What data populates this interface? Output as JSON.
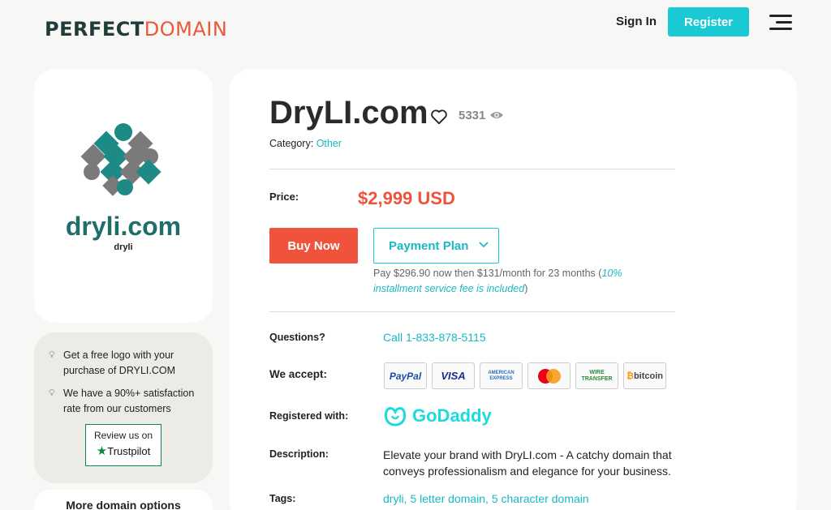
{
  "header": {
    "logo_part1": "PERFECT",
    "logo_part2": "DOMAIN",
    "sign_in": "Sign In",
    "register": "Register"
  },
  "sidebar": {
    "domain_logo_text": "dryli.com",
    "domain_logo_sub": "dryli",
    "info": [
      {
        "text": "Get a free logo with your purchase of DRYLI.COM"
      },
      {
        "text": "We have a 90%+ satisfaction rate from our customers"
      }
    ],
    "trustpilot_review": "Review us on",
    "trustpilot_name": "Trustpilot",
    "more_options": "More domain options"
  },
  "main": {
    "domain_title": "DryLI.com",
    "views": "5331",
    "category_label": "Category:",
    "category_value": "Other",
    "price_label": "Price:",
    "price_value": "$2,999 USD",
    "buy_now": "Buy Now",
    "payment_plan": "Payment Plan",
    "plan_note": "Pay $296.90 now then $131/month for 23 months",
    "plan_note_open": "(",
    "plan_note_fee": "10% installment service fee is included",
    "plan_note_close": ")",
    "questions_label": "Questions?",
    "questions_value": "Call 1-833-878-5115",
    "accept_label": "We accept:",
    "payment_methods": [
      "PayPal",
      "VISA",
      "AMERICAN EXPRESS",
      "MasterCard",
      "WIRE TRANSFER",
      "bitcoin"
    ],
    "registered_label": "Registered with:",
    "registrar": "GoDaddy",
    "description_label": "Description:",
    "description_value": "Elevate your brand with DryLI.com - A catchy domain that conveys professionalism and elegance for your business.",
    "tags_label": "Tags:",
    "tags_value": "dryli, 5 letter domain, 5 character domain"
  },
  "colors": {
    "accent": "#19c9d4",
    "price": "#f0533b",
    "logo_dark": "#1f3b3a",
    "logo_orange": "#e8593b"
  }
}
